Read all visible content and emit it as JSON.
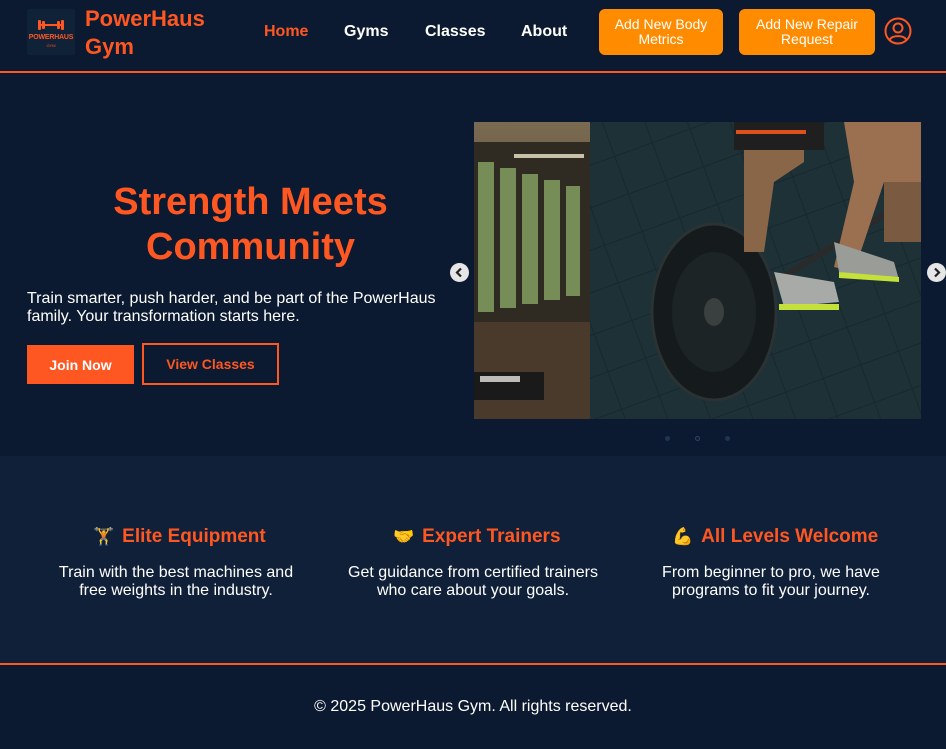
{
  "header": {
    "logo_text": "POWERHAUS",
    "logo_sub": "GYM",
    "brand_line1": "PowerHaus",
    "brand_line2": "Gym",
    "nav": [
      "Home",
      "Gyms",
      "Classes",
      "About"
    ],
    "btn_body_metrics": "Add New Body Metrics",
    "btn_repair": "Add New Repair Request",
    "profile_icon": "user-circle-icon"
  },
  "hero": {
    "title": "Strength Meets Community",
    "text": "Train smarter, push harder, and be part of the PowerHaus family. Your transformation starts here.",
    "join_label": "Join Now",
    "view_label": "View Classes",
    "carousel_active": 2,
    "carousel_count": 3
  },
  "features": [
    {
      "icon": "🏋️",
      "title": "Elite Equipment",
      "text": "Train with the best machines and free weights in the industry."
    },
    {
      "icon": "🤝",
      "title": "Expert Trainers",
      "text": "Get guidance from certified trainers who care about your goals."
    },
    {
      "icon": "💪",
      "title": "All Levels Welcome",
      "text": "From beginner to pro, we have programs to fit your journey."
    }
  ],
  "footer": {
    "text": "© 2025 PowerHaus Gym. All rights reserved."
  },
  "colors": {
    "accent": "#ff5722",
    "button": "#ff8c00",
    "background": "#0b1a30",
    "section": "#102039"
  }
}
